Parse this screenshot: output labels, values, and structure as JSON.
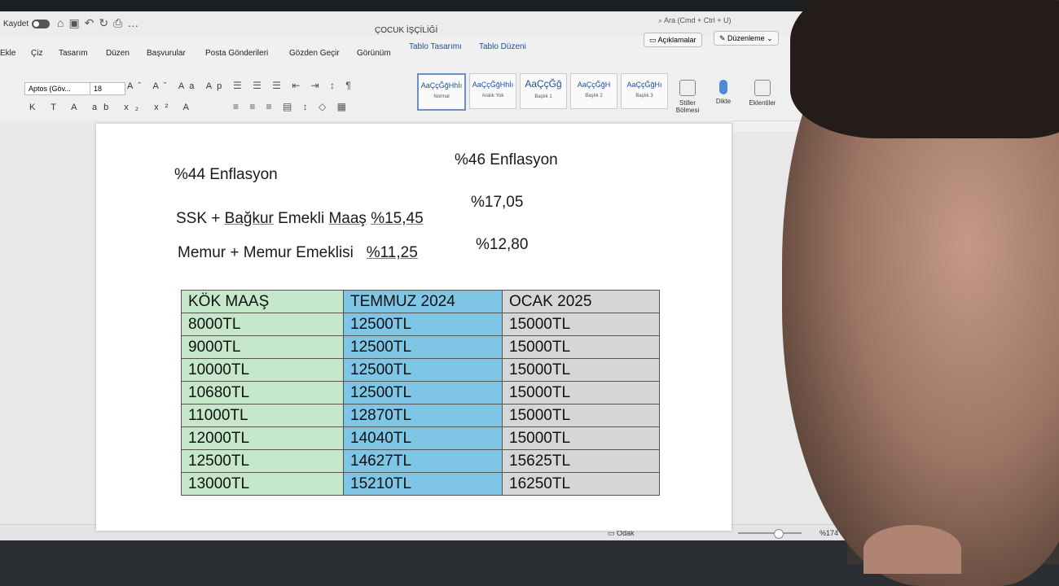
{
  "window": {
    "save_label": "Kaydet",
    "doc_title": "ÇOCUK İŞÇİLİĞİ",
    "search_placeholder": "Ara (Cmd + Ctrl + U)"
  },
  "menu": {
    "items": [
      "Ekle",
      "Çiz",
      "Tasarım",
      "Düzen",
      "Başvurular",
      "Posta Gönderileri",
      "Gözden Geçir",
      "Görünüm",
      "Tablo Tasarımı",
      "Tablo Düzeni"
    ],
    "comments_label": "Açıklamalar",
    "edit_label": "Düzenleme"
  },
  "toolbar": {
    "font_name": "Aptos (Göv...",
    "font_size": "18",
    "styles": [
      {
        "sample": "AaÇçĞğHhİı",
        "label": "Normal"
      },
      {
        "sample": "AaÇçĞğHhİı",
        "label": "Aralık Yok"
      },
      {
        "sample": "AaÇçĞğ",
        "label": "Başlık 1"
      },
      {
        "sample": "AaÇçĞğH",
        "label": "Başlık 2"
      },
      {
        "sample": "AaÇçĞğHı",
        "label": "Başlık 3"
      }
    ],
    "styles_pane_label": "Stiller Bölmesi",
    "dictate_label": "Dikte",
    "addins_label": "Eklentiler"
  },
  "document": {
    "line1_left": "%44 Enflasyon",
    "line1_right": "%46 Enflasyon",
    "line2_left_prefix": "SSK + ",
    "line2_left_bagkur": "Bağkur",
    "line2_left_mid": " Emekli ",
    "line2_left_maas": "Maaş",
    "line2_left_pct": "%15,45",
    "line2_right": "%17,05",
    "line3_left": "Memur + Memur Emeklisi",
    "line3_left_pct": "%11,25",
    "line3_right": "%12,80"
  },
  "table": {
    "headers": [
      "KÖK MAAŞ",
      "TEMMUZ 2024",
      "OCAK 2025"
    ],
    "rows": [
      [
        "8000TL",
        "12500TL",
        "15000TL"
      ],
      [
        "9000TL",
        "12500TL",
        "15000TL"
      ],
      [
        "10000TL",
        "12500TL",
        "15000TL"
      ],
      [
        "10680TL",
        "12500TL",
        "15000TL"
      ],
      [
        "11000TL",
        "12870TL",
        "15000TL"
      ],
      [
        "12000TL",
        "14040TL",
        "15000TL"
      ],
      [
        "12500TL",
        "14627TL",
        "15625TL"
      ],
      [
        "13000TL",
        "15210TL",
        "16250TL"
      ]
    ]
  },
  "status": {
    "focus_label": "Odak",
    "zoom": "%174"
  }
}
